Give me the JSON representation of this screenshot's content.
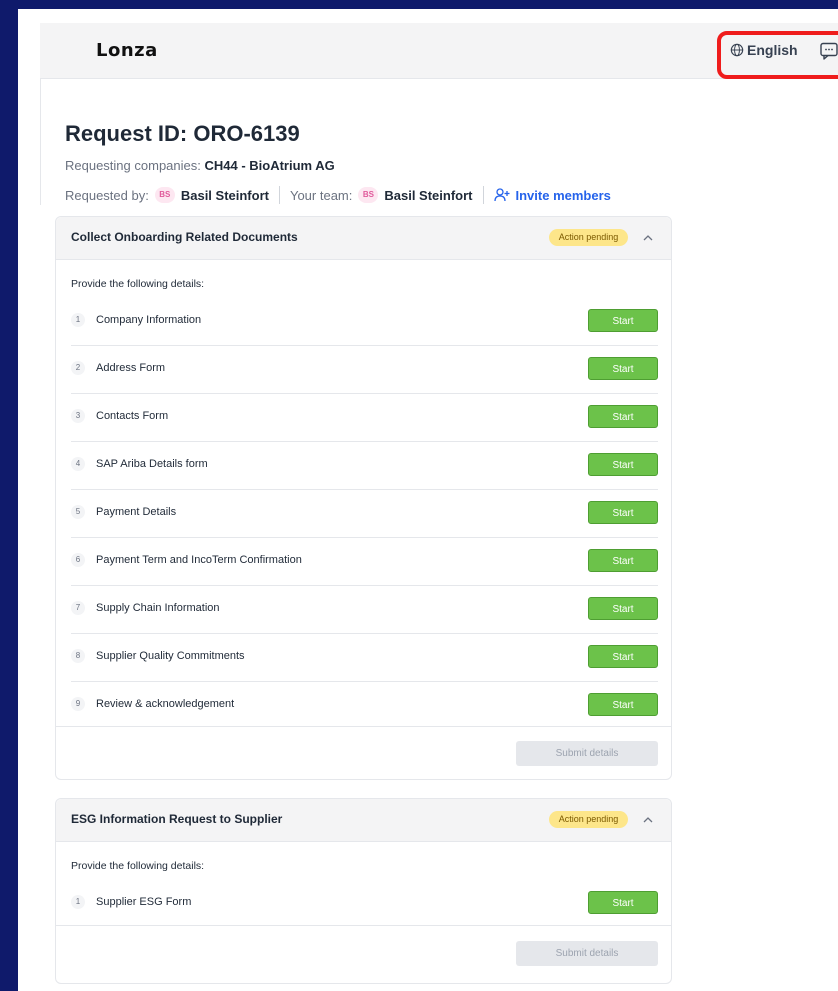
{
  "header": {
    "logo_text": "Lonza",
    "language_label": "English"
  },
  "request": {
    "title": "Request ID: ORO-6139",
    "companies_label": "Requesting companies:",
    "companies_value": "CH44 - BioAtrium AG",
    "requested_by_label": "Requested by:",
    "requested_by_initials": "BS",
    "requested_by_name": "Basil Steinfort",
    "team_label": "Your team:",
    "team_initials": "BS",
    "team_name": "Basil Steinfort",
    "invite_label": "Invite members"
  },
  "sections": [
    {
      "title": "Collect Onboarding Related Documents",
      "status": "Action pending",
      "intro": "Provide the following details:",
      "start_label": "Start",
      "submit_label": "Submit details",
      "items": [
        {
          "num": "1",
          "label": "Company Information"
        },
        {
          "num": "2",
          "label": "Address Form"
        },
        {
          "num": "3",
          "label": "Contacts Form"
        },
        {
          "num": "4",
          "label": "SAP Ariba Details form"
        },
        {
          "num": "5",
          "label": "Payment Details"
        },
        {
          "num": "6",
          "label": "Payment Term and IncoTerm Confirmation"
        },
        {
          "num": "7",
          "label": "Supply Chain Information"
        },
        {
          "num": "8",
          "label": "Supplier Quality Commitments"
        },
        {
          "num": "9",
          "label": "Review & acknowledgement"
        }
      ]
    },
    {
      "title": "ESG Information Request to Supplier",
      "status": "Action pending",
      "intro": "Provide the following details:",
      "start_label": "Start",
      "submit_label": "Submit details",
      "items": [
        {
          "num": "1",
          "label": "Supplier ESG Form"
        }
      ]
    }
  ],
  "colors": {
    "frame": "#0f1a6b",
    "highlight": "#ef1c1c",
    "start_button": "#6cc24a",
    "badge": "#fde68a",
    "link": "#2563eb"
  }
}
